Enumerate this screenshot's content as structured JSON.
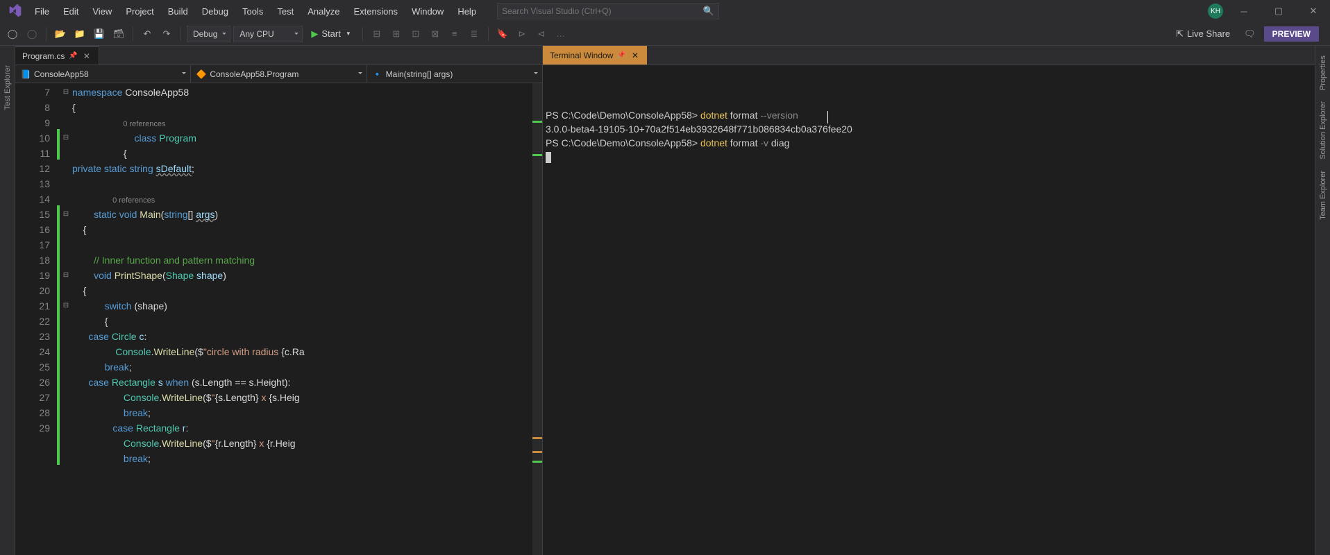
{
  "menus": [
    "File",
    "Edit",
    "View",
    "Project",
    "Build",
    "Debug",
    "Tools",
    "Test",
    "Analyze",
    "Extensions",
    "Window",
    "Help"
  ],
  "search_placeholder": "Search Visual Studio (Ctrl+Q)",
  "avatar_initials": "KH",
  "toolbar": {
    "config": "Debug",
    "platform": "Any CPU",
    "start": "Start",
    "live_share": "Live Share",
    "preview": "PREVIEW"
  },
  "left_side_tabs": [
    "Test Explorer"
  ],
  "right_side_tabs": [
    "Properties",
    "Solution Explorer",
    "Team Explorer"
  ],
  "editor": {
    "file_tab": "Program.cs",
    "nav": {
      "project": "ConsoleApp58",
      "class": "ConsoleApp58.Program",
      "method": "Main(string[] args)"
    },
    "lines": [
      {
        "n": 7,
        "fold": "-",
        "chg": false,
        "t": [
          {
            "c": "kw",
            "s": "namespace"
          },
          {
            "c": "",
            "s": " "
          },
          {
            "c": "lit",
            "s": "ConsoleApp58"
          }
        ]
      },
      {
        "n": 8,
        "fold": "",
        "chg": false,
        "t": [
          {
            "c": "lit",
            "s": "{"
          }
        ]
      },
      {
        "n": "",
        "fold": "",
        "chg": false,
        "t": [
          {
            "c": "ref",
            "s": "                        0 references"
          }
        ]
      },
      {
        "n": 9,
        "fold": "-",
        "chg": true,
        "t": [
          {
            "c": "",
            "s": "                       "
          },
          {
            "c": "kw",
            "s": "class"
          },
          {
            "c": "",
            "s": " "
          },
          {
            "c": "type",
            "s": "Program"
          }
        ]
      },
      {
        "n": 10,
        "fold": "",
        "chg": true,
        "t": [
          {
            "c": "",
            "s": "                   "
          },
          {
            "c": "lit",
            "s": "{"
          }
        ]
      },
      {
        "n": 11,
        "fold": "",
        "chg": false,
        "t": [
          {
            "c": "kw",
            "s": "private"
          },
          {
            "c": "",
            "s": " "
          },
          {
            "c": "kw",
            "s": "static"
          },
          {
            "c": "",
            "s": " "
          },
          {
            "c": "kw",
            "s": "string"
          },
          {
            "c": "",
            "s": " "
          },
          {
            "c": "var squiggle",
            "s": "sDefault"
          },
          {
            "c": "lit",
            "s": ";"
          }
        ]
      },
      {
        "n": 12,
        "fold": "",
        "chg": false,
        "t": []
      },
      {
        "n": "",
        "fold": "",
        "chg": false,
        "t": [
          {
            "c": "ref",
            "s": "                   0 references"
          }
        ]
      },
      {
        "n": 13,
        "fold": "-",
        "chg": true,
        "t": [
          {
            "c": "",
            "s": "        "
          },
          {
            "c": "kw",
            "s": "static"
          },
          {
            "c": "",
            "s": " "
          },
          {
            "c": "kw",
            "s": "void"
          },
          {
            "c": "",
            "s": " "
          },
          {
            "c": "ident",
            "s": "Main"
          },
          {
            "c": "lit",
            "s": "("
          },
          {
            "c": "kw",
            "s": "string"
          },
          {
            "c": "lit",
            "s": "[] "
          },
          {
            "c": "var squiggle",
            "s": "args"
          },
          {
            "c": "lit",
            "s": ")"
          }
        ]
      },
      {
        "n": 14,
        "fold": "",
        "chg": true,
        "t": [
          {
            "c": "",
            "s": "    "
          },
          {
            "c": "lit",
            "s": "{"
          }
        ]
      },
      {
        "n": 15,
        "fold": "",
        "chg": true,
        "t": []
      },
      {
        "n": 16,
        "fold": "",
        "chg": true,
        "t": [
          {
            "c": "",
            "s": "        "
          },
          {
            "c": "cmt",
            "s": "// Inner function and pattern matching"
          }
        ]
      },
      {
        "n": 17,
        "fold": "-",
        "chg": true,
        "t": [
          {
            "c": "",
            "s": "        "
          },
          {
            "c": "kw",
            "s": "void"
          },
          {
            "c": "",
            "s": " "
          },
          {
            "c": "ident",
            "s": "PrintShape"
          },
          {
            "c": "lit",
            "s": "("
          },
          {
            "c": "type",
            "s": "Shape"
          },
          {
            "c": "",
            "s": " "
          },
          {
            "c": "var",
            "s": "shape"
          },
          {
            "c": "lit",
            "s": ")"
          }
        ]
      },
      {
        "n": 18,
        "fold": "",
        "chg": true,
        "t": [
          {
            "c": "",
            "s": "    "
          },
          {
            "c": "lit",
            "s": "{"
          }
        ]
      },
      {
        "n": 19,
        "fold": "-",
        "chg": true,
        "t": [
          {
            "c": "",
            "s": "            "
          },
          {
            "c": "kw",
            "s": "switch"
          },
          {
            "c": "",
            "s": " "
          },
          {
            "c": "lit",
            "s": "(shape)"
          }
        ]
      },
      {
        "n": 20,
        "fold": "",
        "chg": true,
        "t": [
          {
            "c": "",
            "s": "            "
          },
          {
            "c": "lit",
            "s": "{"
          }
        ]
      },
      {
        "n": 21,
        "fold": "",
        "chg": true,
        "t": [
          {
            "c": "",
            "s": "      "
          },
          {
            "c": "kw",
            "s": "case"
          },
          {
            "c": "",
            "s": " "
          },
          {
            "c": "type",
            "s": "Circle"
          },
          {
            "c": "",
            "s": " "
          },
          {
            "c": "var",
            "s": "c"
          },
          {
            "c": "lit",
            "s": ":"
          }
        ]
      },
      {
        "n": 22,
        "fold": "",
        "chg": true,
        "t": [
          {
            "c": "",
            "s": "                "
          },
          {
            "c": "type",
            "s": "Console"
          },
          {
            "c": "lit",
            "s": "."
          },
          {
            "c": "ident",
            "s": "WriteLine"
          },
          {
            "c": "lit",
            "s": "($"
          },
          {
            "c": "str",
            "s": "\"circle with radius "
          },
          {
            "c": "lit",
            "s": "{c.Ra"
          }
        ]
      },
      {
        "n": 23,
        "fold": "",
        "chg": true,
        "t": [
          {
            "c": "",
            "s": "            "
          },
          {
            "c": "kw",
            "s": "break"
          },
          {
            "c": "lit",
            "s": ";"
          }
        ]
      },
      {
        "n": 24,
        "fold": "",
        "chg": true,
        "t": [
          {
            "c": "",
            "s": "      "
          },
          {
            "c": "kw",
            "s": "case"
          },
          {
            "c": "",
            "s": " "
          },
          {
            "c": "type",
            "s": "Rectangle"
          },
          {
            "c": "",
            "s": " "
          },
          {
            "c": "var",
            "s": "s"
          },
          {
            "c": "",
            "s": " "
          },
          {
            "c": "kw",
            "s": "when"
          },
          {
            "c": "",
            "s": " "
          },
          {
            "c": "lit",
            "s": "(s.Length == s.Height):"
          }
        ]
      },
      {
        "n": 25,
        "fold": "",
        "chg": true,
        "t": [
          {
            "c": "",
            "s": "                   "
          },
          {
            "c": "type",
            "s": "Console"
          },
          {
            "c": "lit",
            "s": "."
          },
          {
            "c": "ident",
            "s": "WriteLine"
          },
          {
            "c": "lit",
            "s": "($"
          },
          {
            "c": "str",
            "s": "\""
          },
          {
            "c": "lit",
            "s": "{s.Length}"
          },
          {
            "c": "str",
            "s": " x "
          },
          {
            "c": "lit",
            "s": "{s.Heig"
          }
        ]
      },
      {
        "n": 26,
        "fold": "",
        "chg": true,
        "t": [
          {
            "c": "",
            "s": "                   "
          },
          {
            "c": "kw",
            "s": "break"
          },
          {
            "c": "lit",
            "s": ";"
          }
        ]
      },
      {
        "n": 27,
        "fold": "",
        "chg": true,
        "t": [
          {
            "c": "",
            "s": "               "
          },
          {
            "c": "kw",
            "s": "case"
          },
          {
            "c": "",
            "s": " "
          },
          {
            "c": "type",
            "s": "Rectangle"
          },
          {
            "c": "",
            "s": " "
          },
          {
            "c": "var",
            "s": "r"
          },
          {
            "c": "lit",
            "s": ":"
          }
        ]
      },
      {
        "n": 28,
        "fold": "",
        "chg": true,
        "t": [
          {
            "c": "",
            "s": "                   "
          },
          {
            "c": "type",
            "s": "Console"
          },
          {
            "c": "lit",
            "s": "."
          },
          {
            "c": "ident",
            "s": "WriteLine"
          },
          {
            "c": "lit",
            "s": "($"
          },
          {
            "c": "str",
            "s": "\""
          },
          {
            "c": "lit",
            "s": "{r.Length}"
          },
          {
            "c": "str",
            "s": " x "
          },
          {
            "c": "lit",
            "s": "{r.Heig"
          }
        ]
      },
      {
        "n": 29,
        "fold": "",
        "chg": true,
        "t": [
          {
            "c": "",
            "s": "                   "
          },
          {
            "c": "kw",
            "s": "break"
          },
          {
            "c": "lit",
            "s": ";"
          }
        ]
      }
    ]
  },
  "terminal": {
    "tab_label": "Terminal Window",
    "lines": [
      {
        "segments": [
          {
            "c": "ps-path",
            "s": "PS C:\\Code\\Demo\\ConsoleApp58> "
          },
          {
            "c": "ps-cmd",
            "s": "dotnet"
          },
          {
            "c": "ps-arg",
            "s": " format "
          },
          {
            "c": "ps-flag",
            "s": "--version"
          }
        ]
      },
      {
        "segments": [
          {
            "c": "ps-arg",
            "s": "3.0.0-beta4-19105-10+70a2f514eb3932648f771b086834cb0a376fee20"
          }
        ]
      },
      {
        "segments": [
          {
            "c": "ps-path",
            "s": "PS C:\\Code\\Demo\\ConsoleApp58> "
          },
          {
            "c": "ps-cmd",
            "s": "dotnet"
          },
          {
            "c": "ps-arg",
            "s": " format "
          },
          {
            "c": "ps-flag",
            "s": "-v"
          },
          {
            "c": "ps-arg",
            "s": " diag"
          }
        ]
      }
    ]
  }
}
